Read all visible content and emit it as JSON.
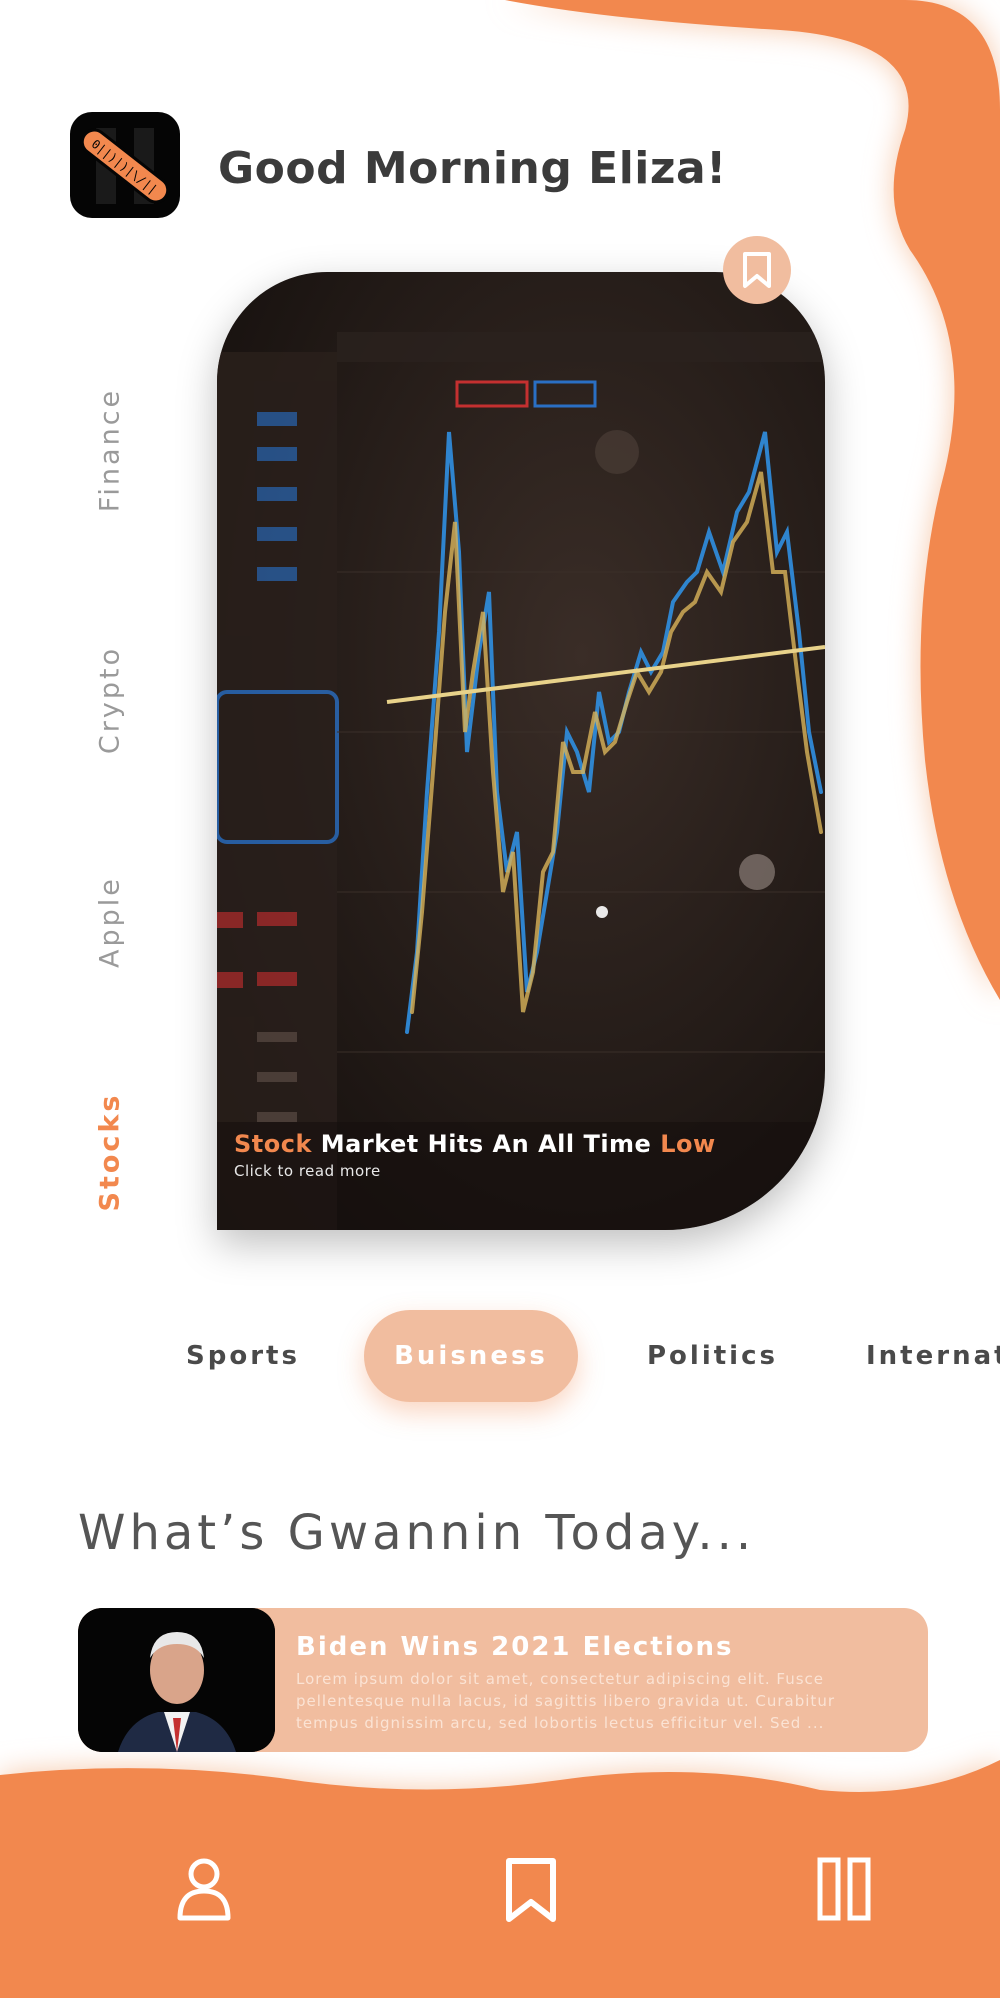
{
  "colors": {
    "accent": "#f2884e",
    "accent_light": "#f1bd9f",
    "text_dark": "#3b3b3b"
  },
  "header": {
    "greeting": "Good Morning Eliza!",
    "logo_icon": "n-logo-icon"
  },
  "side_categories": [
    {
      "label": "Finance",
      "active": false
    },
    {
      "label": "Crypto",
      "active": false
    },
    {
      "label": "Apple",
      "active": false
    },
    {
      "label": "Stocks",
      "active": true
    }
  ],
  "hero": {
    "title_word1": "Stock",
    "title_middle": " Market Hits An All Time ",
    "title_word2": "Low",
    "subtitle": "Click to read more",
    "bookmark_icon": "bookmark-icon"
  },
  "tabs": [
    {
      "label": "Sports",
      "active": false
    },
    {
      "label": "Buisness",
      "active": true
    },
    {
      "label": "Politics",
      "active": false
    },
    {
      "label": "Internat",
      "active": false
    }
  ],
  "section": {
    "title": "What’s Gwannin Today..."
  },
  "news": [
    {
      "title": "Biden Wins 2021 Elections",
      "body": "Lorem ipsum dolor sit amet, consectetur adipiscing elit. Fusce pellentesque nulla lacus, id sagittis libero gravida ut. Curabitur tempus dignissim arcu, sed lobortis lectus efficitur vel. Sed ..."
    }
  ],
  "bottom_nav": [
    {
      "name": "profile",
      "icon": "user-icon"
    },
    {
      "name": "bookmarks",
      "icon": "bookmark-icon"
    },
    {
      "name": "columns",
      "icon": "columns-icon"
    }
  ]
}
